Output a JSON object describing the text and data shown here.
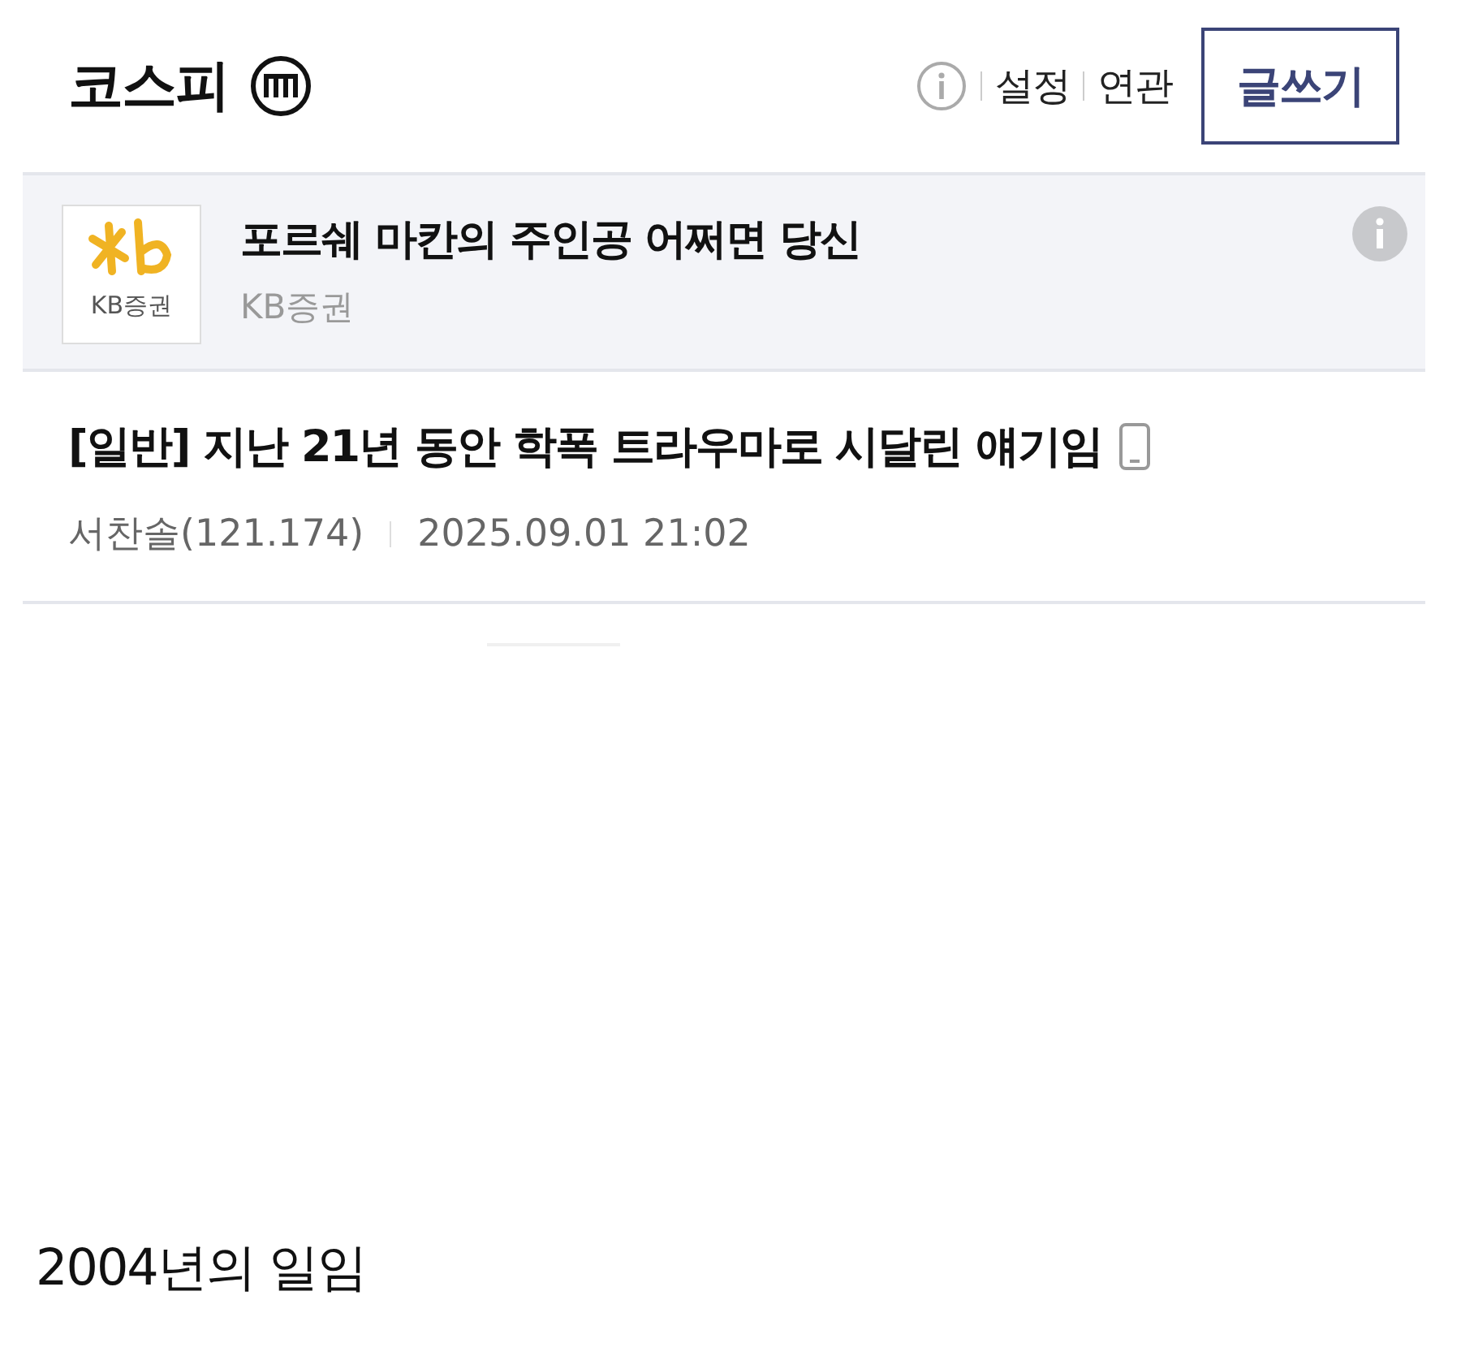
{
  "header": {
    "title": "코스피",
    "links": [
      "설정",
      "연관"
    ],
    "write_button": "글쓰기"
  },
  "ad": {
    "logo_text": "KB증권",
    "title": "포르쉐 마칸의 주인공 어쩌면 당신",
    "sponsor": "KB증권"
  },
  "post": {
    "category": "[일반]",
    "title": "지난 21년 동안 학폭 트라우마로 시달린 얘기임",
    "author": "서찬솔(121.174)",
    "date": "2025.09.01 21:02",
    "body": "2004년의 일임"
  }
}
